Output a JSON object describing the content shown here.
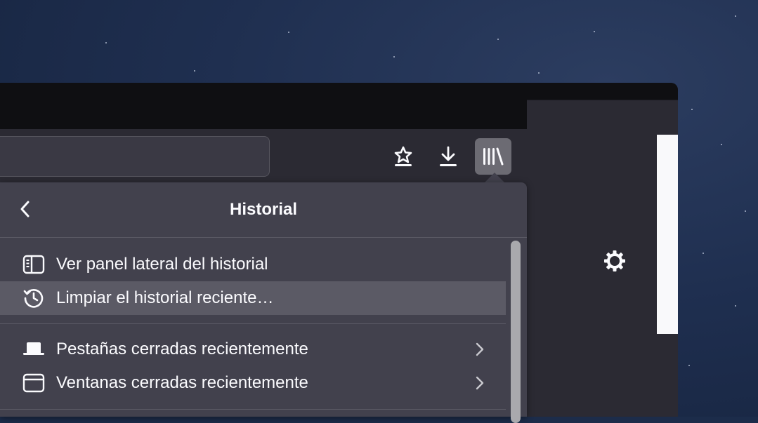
{
  "panel": {
    "title": "Historial",
    "items": [
      {
        "label": "Ver panel lateral del historial",
        "icon": "sidebar-icon"
      },
      {
        "label": "Limpiar el historial reciente…",
        "icon": "history-clock-icon"
      },
      {
        "label": "Pestañas cerradas recientemente",
        "icon": "tab-icon",
        "submenu": true
      },
      {
        "label": "Ventanas cerradas recientemente",
        "icon": "window-icon",
        "submenu": true
      }
    ]
  },
  "toolbar": {
    "buttons": [
      "bookmark-star-icon",
      "download-icon",
      "library-icon",
      "sidebar-icon",
      "account-icon",
      "menu-icon"
    ],
    "active": "library-icon"
  },
  "colors": {
    "panel_bg": "#42414d",
    "hover_bg": "#5b5a65",
    "toolbar_bg": "#2b2a33",
    "text": "#fbfbfe"
  }
}
